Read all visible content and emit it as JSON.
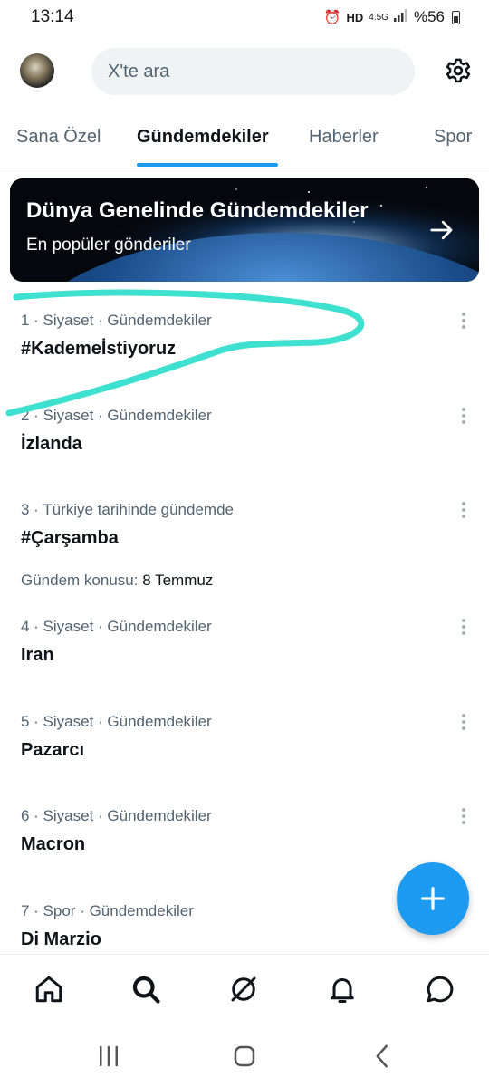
{
  "status_bar": {
    "time": "13:14",
    "battery_text": "%56",
    "icons": [
      "alarm-icon",
      "hd-icon",
      "4g-icon",
      "signal-icon",
      "battery-icon"
    ]
  },
  "header": {
    "search_placeholder": "X'te ara"
  },
  "tabs": [
    {
      "label": "Sana Özel",
      "active": false
    },
    {
      "label": "Gündemdekiler",
      "active": true
    },
    {
      "label": "Haberler",
      "active": false
    },
    {
      "label": "Spor",
      "active": false
    }
  ],
  "banner": {
    "title": "Dünya Genelinde Gündemdekiler",
    "subtitle": "En popüler gönderiler"
  },
  "trends": [
    {
      "meta": "1 · Siyaset · Gündemdekiler",
      "title": "#Kademeİstiyoruz"
    },
    {
      "meta": "2 · Siyaset · Gündemdekiler",
      "title": "İzlanda"
    },
    {
      "meta": "3 · Türkiye tarihinde gündemde",
      "title": "#Çarşamba",
      "extra_label": "Gündem konusu:",
      "extra_value": "8 Temmuz"
    },
    {
      "meta": "4 · Siyaset · Gündemdekiler",
      "title": "Iran"
    },
    {
      "meta": "5 · Siyaset · Gündemdekiler",
      "title": "Pazarcı"
    },
    {
      "meta": "6 · Siyaset · Gündemdekiler",
      "title": "Macron"
    },
    {
      "meta": "7 · Spor · Gündemdekiler",
      "title": "Di Marzio"
    }
  ],
  "bottom_nav": [
    "home-icon",
    "search-icon",
    "grok-icon",
    "notifications-icon",
    "messages-icon"
  ],
  "colors": {
    "accent": "#1d9bf0",
    "text_primary": "#0f1419",
    "text_secondary": "#536471",
    "annotation": "#3ee0cf"
  }
}
